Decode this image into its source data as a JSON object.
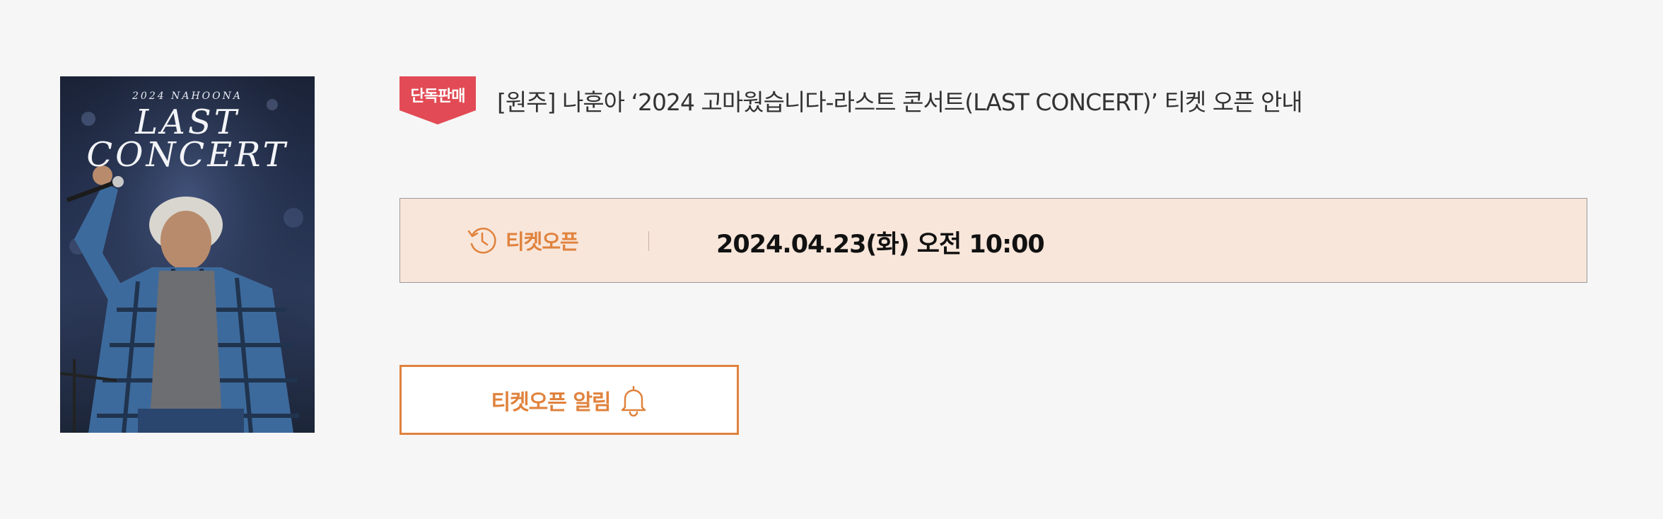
{
  "poster": {
    "year_line": "2024 NAHOONA",
    "title_line1": "LAST",
    "title_line2": "CONCERT"
  },
  "badge": {
    "label": "단독판매"
  },
  "notice": {
    "title": "[원주] 나훈아 ‘2024 고마웠습니다-라스트 콘서트(LAST CONCERT)’ 티켓 오픈 안내"
  },
  "ticket_open": {
    "label": "티켓오픈",
    "value": "2024.04.23(화) 오전 10:00",
    "icon": "clock-history-icon"
  },
  "notify_button": {
    "label": "티켓오픈 알림",
    "icon": "bell-icon"
  },
  "colors": {
    "accent": "#e0823d",
    "badge": "#e24b55",
    "info_bg": "#f8e6da",
    "page_bg": "#f6f6f6"
  }
}
